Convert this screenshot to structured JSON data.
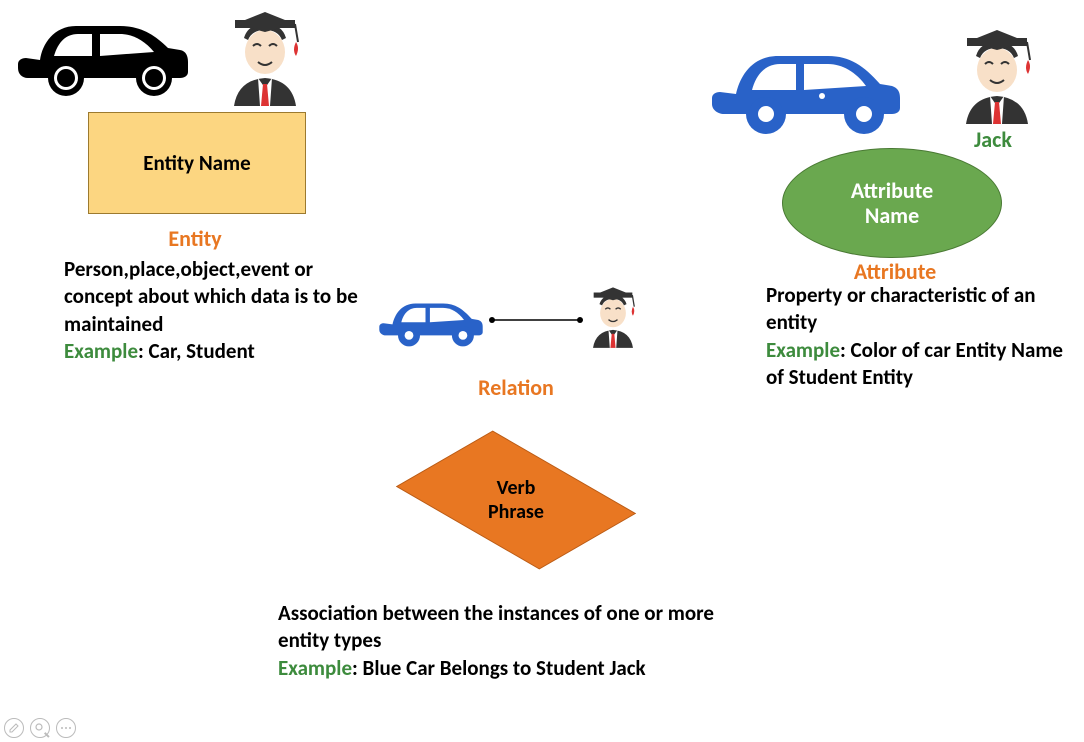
{
  "entity": {
    "box_label": "Entity Name",
    "title": "Entity",
    "desc": "Person,place,object,event or concept about which data is to be maintained",
    "example_label": "Example",
    "example_text": ": Car, Student"
  },
  "attribute": {
    "ellipse_label": "Attribute Name",
    "title": "Attribute",
    "desc": "Property or characteristic of an entity",
    "example_label": "Example",
    "example_text": ": Color of car Entity Name of Student Entity",
    "icon_caption": "Jack"
  },
  "relation": {
    "diamond_label": "Verb Phrase",
    "title": "Relation",
    "desc": "Association between the instances of one or more entity types",
    "example_label": "Example",
    "example_text": ": Blue Car Belongs to Student Jack"
  }
}
